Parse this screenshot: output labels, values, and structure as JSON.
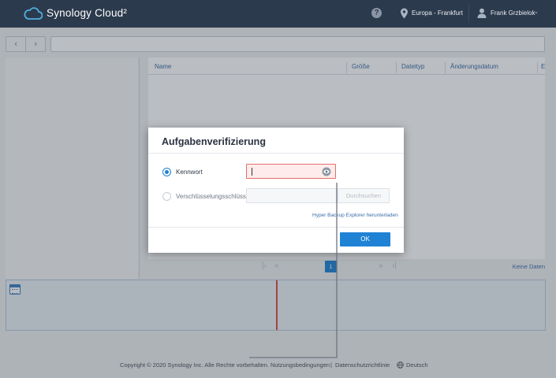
{
  "header": {
    "brand": "Synology Cloud²",
    "region": "Europa - Frankfurt",
    "user": "Frank Grzbielok",
    "help_glyph": "?",
    "chevron_glyph": "⌄",
    "icons": [
      "cloud-logo-icon",
      "help-icon",
      "location-pin-icon",
      "user-icon",
      "chevron-down-icon"
    ]
  },
  "toolbar": {
    "back_glyph": "‹",
    "forward_glyph": "›",
    "path": ""
  },
  "table": {
    "columns": [
      "Name",
      "Größe",
      "Dateityp",
      "Änderungsdatum",
      "E"
    ]
  },
  "pager": {
    "first": "|‹",
    "prev": "«",
    "current": "1",
    "next": "»",
    "last": "›|",
    "status": "Keine Daten"
  },
  "dialog": {
    "title": "Aufgabenverifizierung",
    "option_password_label": "Kennwort",
    "option_password_selected": true,
    "password_value": "",
    "option_key_label": "Verschlüsselungsschlüssel",
    "option_key_selected": false,
    "key_value": "",
    "browse_label": "Durchsuchen",
    "explorer_link": "Hyper Backup Explorer herunterladen",
    "ok_label": "OK"
  },
  "footer": {
    "copyright": "Copyright © 2020 Synology Inc. Alle Rechte vorbehalten.",
    "terms": "Nutzungsbedingungen",
    "separator": "|",
    "privacy": "Datenschutzrichtlinie",
    "language": "Deutsch"
  },
  "colors": {
    "header_bg": "#2c3a4d",
    "accent": "#1f82d4",
    "link": "#3b6ea8",
    "error_border": "#e06f66",
    "error_bg": "#fdeceb",
    "timeline_marker": "#e14a3c",
    "cloud_logo": "#4fb0e0"
  }
}
